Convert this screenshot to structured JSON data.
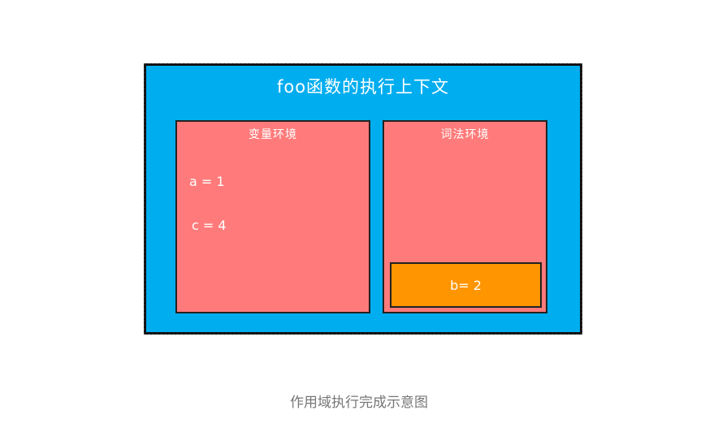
{
  "diagram": {
    "title": "foo函数的执行上下文",
    "variable_environment": {
      "label": "变量环境",
      "entries": [
        "a = 1",
        "c = 4"
      ]
    },
    "lexical_environment": {
      "label": "词法环境",
      "block_entries": [
        "b= 2"
      ]
    },
    "colors": {
      "context_background": "#00adef",
      "environment_background": "#ff7b7b",
      "block_background": "#ff9500"
    }
  },
  "caption": "作用域执行完成示意图"
}
